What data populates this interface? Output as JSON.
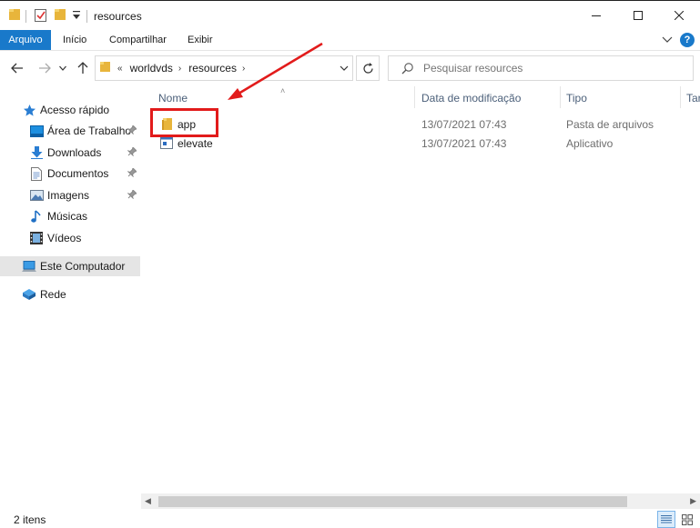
{
  "window": {
    "title": "resources",
    "minimize": "—",
    "maximize": "☐",
    "close": "✕"
  },
  "ribbon": {
    "tabs": [
      "Arquivo",
      "Início",
      "Compartilhar",
      "Exibir"
    ]
  },
  "navigation": {
    "breadcrumb_prefix": "«",
    "breadcrumbs": [
      "worldvds",
      "resources"
    ],
    "search_placeholder": "Pesquisar resources"
  },
  "sidebar": {
    "quick_access": "Acesso rápido",
    "items": [
      "Área de Trabalho",
      "Downloads",
      "Documentos",
      "Imagens",
      "Músicas",
      "Vídeos"
    ],
    "this_pc": "Este Computador",
    "network": "Rede"
  },
  "columns": {
    "name": "Nome",
    "date": "Data de modificação",
    "type": "Tipo",
    "size": "Tar"
  },
  "files": [
    {
      "name": "app",
      "date": "13/07/2021 07:43",
      "type": "Pasta de arquivos",
      "icon": "folder-icon"
    },
    {
      "name": "elevate",
      "date": "13/07/2021 07:43",
      "type": "Aplicativo",
      "icon": "application-icon"
    }
  ],
  "status": {
    "count": "2 itens"
  },
  "colors": {
    "accent": "#1979ca",
    "folder": "#e8b53b",
    "annotation": "#e21b1b"
  }
}
